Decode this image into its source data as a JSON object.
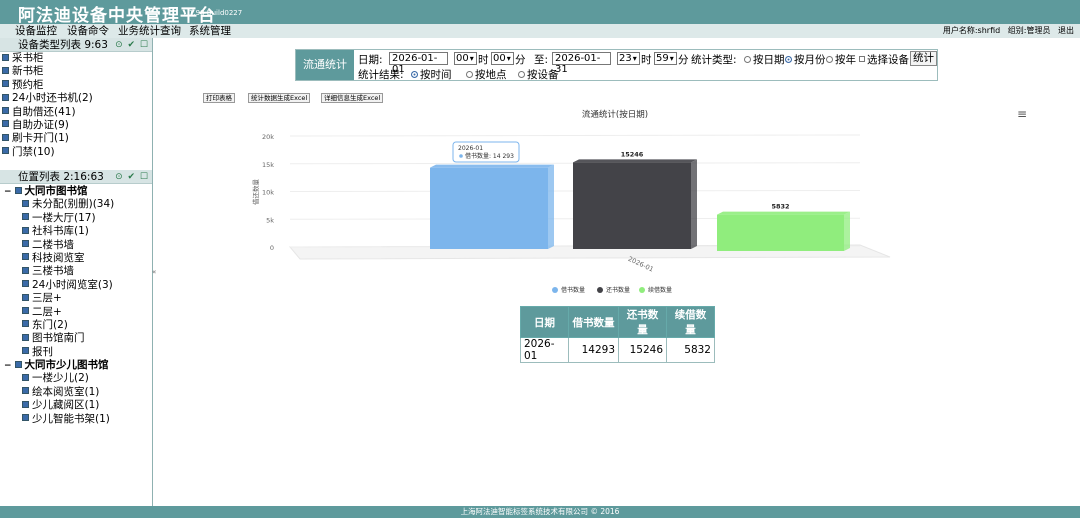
{
  "app": {
    "title": "阿法迪设备中央管理平台",
    "version": "1.98 Build0227"
  },
  "menu": [
    {
      "label": "设备监控"
    },
    {
      "label": "设备命令"
    },
    {
      "label": "业务统计查询"
    },
    {
      "label": "系统管理"
    }
  ],
  "user": {
    "name": "用户名称:shrfid",
    "group": "组别:管理员",
    "logout": "退出"
  },
  "sidebar": {
    "device_panel": {
      "title": "设备类型列表 9:63",
      "tools": [
        "⊙",
        "✔",
        "☐"
      ]
    },
    "device_types": [
      {
        "label": "采书柜"
      },
      {
        "label": "新书柜"
      },
      {
        "label": "预约柜"
      },
      {
        "label": "24小时还书机(2)"
      },
      {
        "label": "自助借还(41)"
      },
      {
        "label": "自助办证(9)"
      },
      {
        "label": "刷卡开门(1)"
      },
      {
        "label": "门禁(10)"
      }
    ],
    "location_panel": {
      "title": "位置列表 2:16:63",
      "tools": [
        "⊙",
        "✔",
        "☐"
      ]
    },
    "libraries": [
      {
        "name": "大同市图书馆",
        "items": [
          {
            "label": "未分配(别删)(34)"
          },
          {
            "label": "一楼大厅(17)"
          },
          {
            "label": "社科书库(1)"
          },
          {
            "label": "二楼书墙"
          },
          {
            "label": "科技阅览室"
          },
          {
            "label": "三楼书墙"
          },
          {
            "label": "24小时阅览室(3)"
          },
          {
            "label": "三层+"
          },
          {
            "label": "二层+"
          },
          {
            "label": "东门(2)"
          },
          {
            "label": "图书馆南门"
          },
          {
            "label": "报刊"
          }
        ]
      },
      {
        "name": "大同市少儿图书馆",
        "items": [
          {
            "label": "一楼少儿(2)"
          },
          {
            "label": "绘本阅览室(1)"
          },
          {
            "label": "少儿藏阅区(1)"
          },
          {
            "label": "少儿智能书架(1)"
          }
        ]
      }
    ]
  },
  "filter": {
    "section_label": "流通统计",
    "date_label": "日期:",
    "start_date": "2026-01-01",
    "start_hour": "00",
    "hour_unit": "时",
    "start_min": "00",
    "min_unit": "分",
    "to_label": "至:",
    "end_date": "2026-01-31",
    "end_hour": "23",
    "end_min": "59",
    "stat_type_label": "统计类型:",
    "stat_types": [
      {
        "label": "按日期",
        "checked": false
      },
      {
        "label": "按月份",
        "checked": true
      },
      {
        "label": "按年",
        "checked": false
      }
    ],
    "select_device": "选择设备",
    "stat_button": "统计",
    "result_label": "统计结果:",
    "result_types": [
      {
        "label": "按时间",
        "checked": true
      },
      {
        "label": "按地点",
        "checked": false
      },
      {
        "label": "按设备",
        "checked": false
      }
    ]
  },
  "actions": {
    "print": "打印表格",
    "export_stats": "统计数据生成Excel",
    "export_detail": "详细信息生成Excel"
  },
  "chart_data": {
    "type": "bar",
    "title": "流通统计(按日期)",
    "ylabel": "借还数量",
    "categories": [
      "2026-01"
    ],
    "ylim": [
      0,
      20000
    ],
    "yticks": [
      "0",
      "5k",
      "10k",
      "15k",
      "20k"
    ],
    "series": [
      {
        "name": "借书数量",
        "values": [
          14293
        ],
        "color": "#7cb5ec"
      },
      {
        "name": "还书数量",
        "values": [
          15246
        ],
        "color": "#434348"
      },
      {
        "name": "续借数量",
        "values": [
          5832
        ],
        "color": "#90ed7d"
      }
    ],
    "data_labels": [
      "",
      "15246",
      "5832"
    ],
    "legend_position": "bottom",
    "tooltip": {
      "title": "2026-01",
      "text": "借书数量: 14 293"
    }
  },
  "menu_icon": "hamburger-icon",
  "table": {
    "headers": [
      "日期",
      "借书数量",
      "还书数量",
      "续借数量"
    ],
    "rows": [
      [
        "2026-01",
        "14293",
        "15246",
        "5832"
      ]
    ]
  },
  "footer": "上海阿法迪智能标签系统技术有限公司 © 2016"
}
